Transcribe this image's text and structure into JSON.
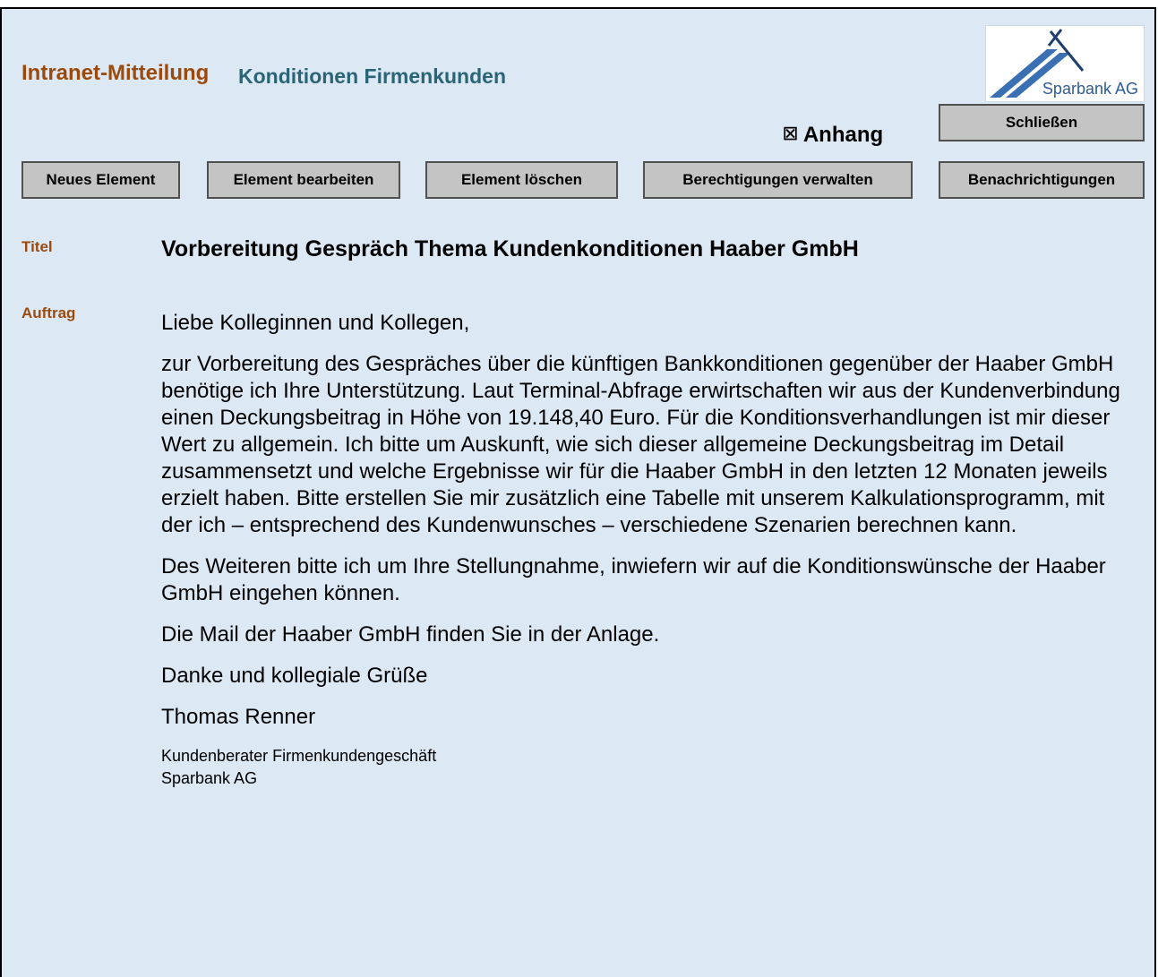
{
  "header": {
    "app_title": "Intranet-Mitteilung",
    "section_title": "Konditionen Firmenkunden",
    "logo_text": "Sparbank AG"
  },
  "attachment": {
    "checkbox_glyph": "☒",
    "label": "Anhang"
  },
  "toolbar": {
    "close_label": "Schließen",
    "new_label": "Neues Element",
    "edit_label": "Element bearbeiten",
    "delete_label": "Element löschen",
    "permissions_label": "Berechtigungen verwalten",
    "notifications_label": "Benachrichtigungen"
  },
  "item": {
    "title_label": "Titel",
    "title": "Vorbereitung Gespräch Thema Kundenkonditionen Haaber GmbH",
    "task_label": "Auftrag",
    "greeting": "Liebe Kolleginnen und Kollegen,",
    "paragraph1": "zur Vorbereitung des Gespräches über die künftigen Bankkonditionen gegenüber der Haaber GmbH benötige ich Ihre Unterstützung. Laut Terminal-Abfrage erwirtschaften wir aus der Kundenverbindung einen Deckungsbeitrag in Höhe von 19.148,40 Euro. Für die Konditionsverhandlungen ist mir dieser Wert zu allgemein. Ich bitte um Auskunft, wie sich dieser allgemeine Deckungsbeitrag im Detail zusammensetzt und welche Ergebnisse wir für die Haaber GmbH in den letzten 12 Monaten jeweils erzielt haben. Bitte erstellen Sie mir zusätzlich eine Tabelle mit unserem Kalkulationsprogramm, mit der ich – entsprechend des Kundenwunsches – verschiedene Szenarien berechnen kann.",
    "paragraph2": "Des Weiteren bitte ich um Ihre Stellungnahme, inwiefern wir auf die Konditionswünsche der Haaber GmbH eingehen können.",
    "paragraph3": "Die Mail der Haaber GmbH finden Sie in der Anlage.",
    "closing": "Danke und kollegiale Grüße",
    "sender_name": "Thomas Renner",
    "sender_role": "Kundenberater Firmenkundengeschäft",
    "sender_company": "Sparbank AG"
  },
  "colors": {
    "background": "#dde8f5",
    "label_brown": "#9c4a0c",
    "section_teal": "#2a6477",
    "button_gray": "#c4c4c4",
    "logo_blue": "#2d5c9a"
  }
}
